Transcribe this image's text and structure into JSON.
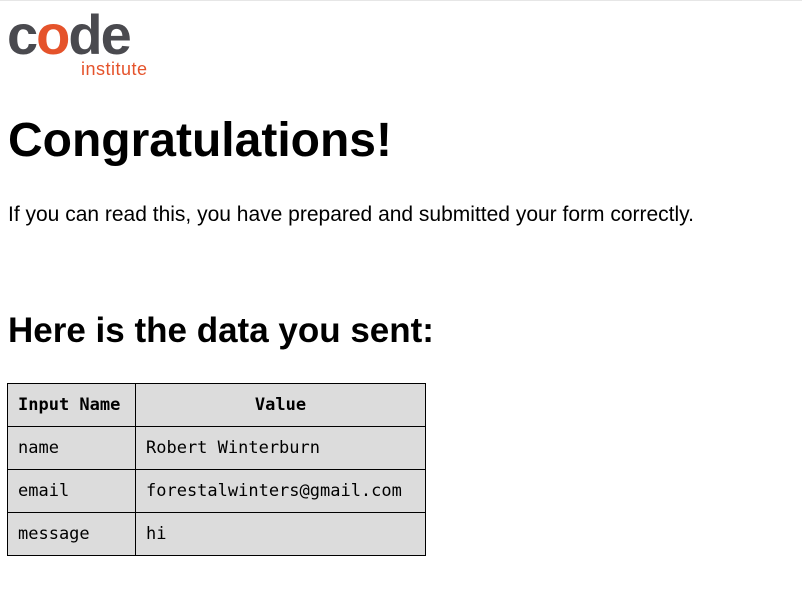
{
  "logo": {
    "word_prefix": "c",
    "word_accent": "o",
    "word_suffix": "de",
    "subtext": "institute",
    "colors": {
      "dark": "#4a4a4f",
      "accent": "#e5532b"
    }
  },
  "heading": "Congratulations!",
  "message": "If you can read this, you have prepared and submitted your form correctly.",
  "subheading": "Here is the data you sent:",
  "table": {
    "headers": [
      "Input Name",
      "Value"
    ],
    "rows": [
      {
        "name": "name",
        "value": "Robert Winterburn"
      },
      {
        "name": "email",
        "value": "forestalwinters@gmail.com"
      },
      {
        "name": "message",
        "value": "hi"
      }
    ]
  }
}
